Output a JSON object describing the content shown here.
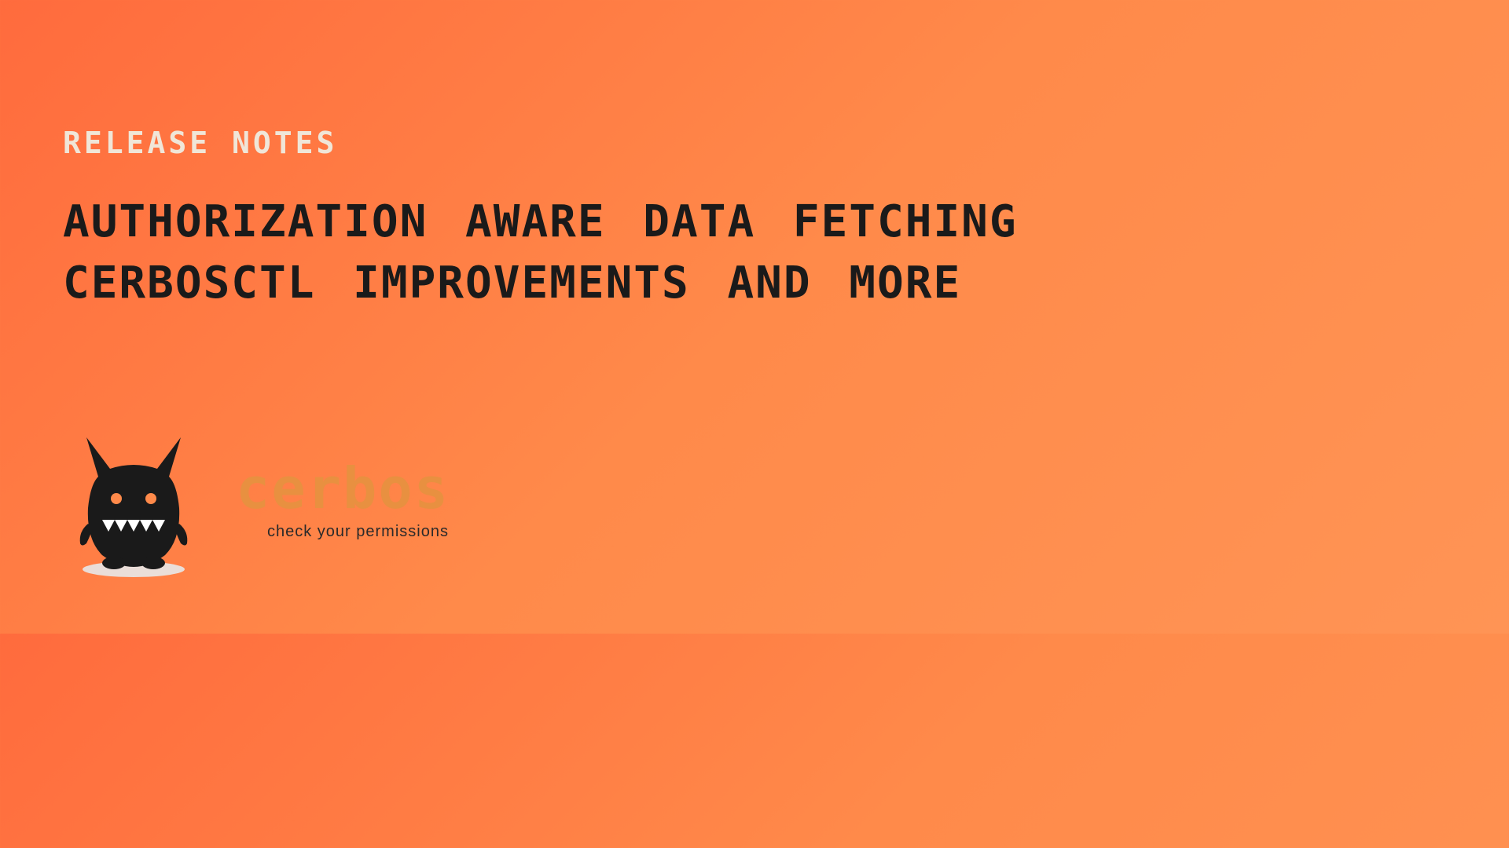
{
  "header": {
    "subtitle": "RELEASE NOTES",
    "title_line1": "AUTHORIZATION AWARE DATA FETCHING",
    "title_line2": "CERBOSCTL IMPROVEMENTS AND MORE"
  },
  "brand": {
    "name": "cerbos",
    "tagline": "check your permissions"
  }
}
